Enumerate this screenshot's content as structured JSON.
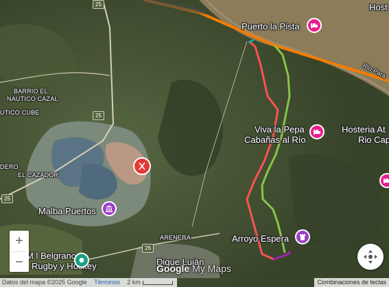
{
  "map": {
    "labels": {
      "host": "Host",
      "puerto_la_pista": "Puerto la Pista",
      "rio_parana": "Rio Para",
      "viva_la_pepa": "Viva la Pepa",
      "cabanas": "Cabañas al Río",
      "hosteria": "Hosteria At",
      "rio_cap": "Rio Cap",
      "barrio_nautico_cazal_1": "BARRIO EL",
      "barrio_nautico_cazal_2": "NAUTICO CAZAL",
      "nautico_cube": "UTICO CUBE",
      "el_cazador": "EL CAZADOR",
      "dero": "DERO",
      "malba_puertos": "Malba Puertos",
      "arenera": "ARENERA",
      "arroyo_espera": "Arroyo Espera",
      "dique_lujan": "Dique Luján",
      "belgrano_1": "M    l Belgrano",
      "belgrano_2": "Rugby y Hockey"
    },
    "road_shields": [
      "25",
      "25",
      "26",
      "25"
    ],
    "route_colors": {
      "orange": "#f57c00",
      "red": "#ff5252",
      "green": "#8bc34a",
      "purple": "#9c27b0",
      "teal": "#26a69a"
    },
    "poi_icons": {
      "hotel": "hotel-icon",
      "restaurant": "restaurant-icon",
      "museum": "museum-icon",
      "landmark": "landmark-icon",
      "park": "park-icon"
    },
    "pin_colors": {
      "hotel": "#e91e8c",
      "restaurant": "#e53935",
      "museum": "#9c3fc6",
      "park": "#16a085"
    }
  },
  "controls": {
    "zoom_in": "+",
    "zoom_out": "−"
  },
  "branding": {
    "google": "Google",
    "my_maps": " My Maps"
  },
  "footer": {
    "attribution": "Datos del mapa ©2025 Google",
    "terms": "Términos",
    "scale": "2 km",
    "shortcuts": "Combinaciones de teclas"
  }
}
